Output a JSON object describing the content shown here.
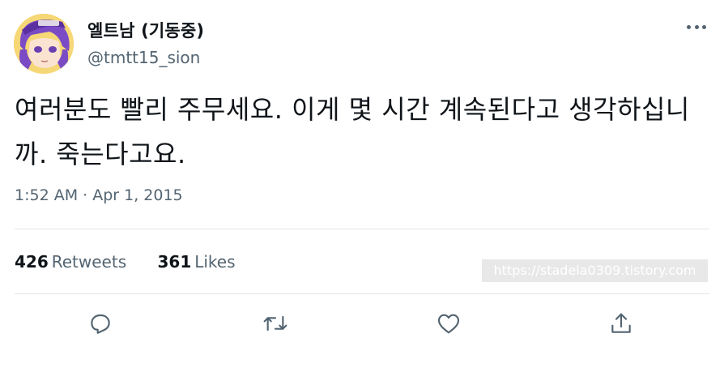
{
  "author": {
    "display_name": "엘트남 (기동중)",
    "handle": "@tmtt15_sion"
  },
  "tweet": {
    "text": "여러분도 빨리 주무세요. 이게 몇 시간 계속된다고 생각하십니까. 죽는다고요.",
    "timestamp": "1:52 AM · Apr 1, 2015"
  },
  "stats": {
    "retweets_count": "426",
    "retweets_label": "Retweets",
    "likes_count": "361",
    "likes_label": "Likes"
  },
  "watermark": "https://stadela0309.tistory.com",
  "actions": [
    {
      "name": "reply",
      "icon": "reply-icon"
    },
    {
      "name": "retweet",
      "icon": "retweet-icon"
    },
    {
      "name": "like",
      "icon": "heart-icon"
    },
    {
      "name": "share",
      "icon": "share-icon"
    }
  ],
  "colors": {
    "text": "#0f1419",
    "secondary": "#536471",
    "divider": "#e3e6e8"
  }
}
